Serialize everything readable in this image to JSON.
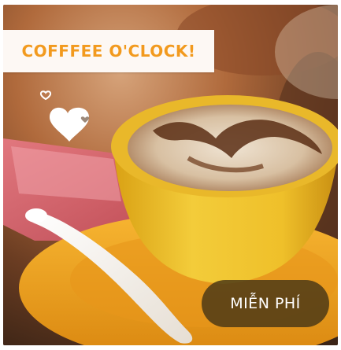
{
  "card": {
    "title": "COFFFEE O'CLOCK!",
    "badge_label": "MIỄN PHÍ",
    "image_icon": "coffee-cup-latte-art-photo",
    "decor_icon": "hearts-icon",
    "colors": {
      "title": "#f29a1e",
      "badge_bg": "#4e3a16",
      "cup": "#f1c12a",
      "saucer": "#f2a21e"
    }
  }
}
